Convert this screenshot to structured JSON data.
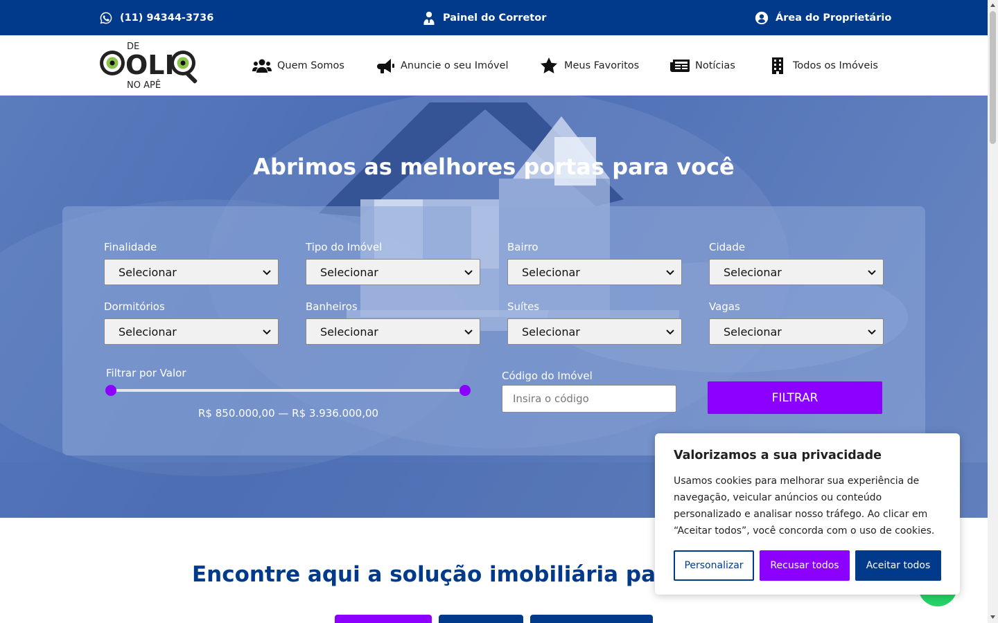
{
  "topbar": {
    "phone": "(11) 94344-3736",
    "broker_panel": "Painel do Corretor",
    "owner_area": "Área do Proprietário"
  },
  "logo": {
    "top": "DE",
    "main": "OLH",
    "bottom": "NO APÊ"
  },
  "nav": [
    {
      "label": "Quem Somos",
      "icon": "users-icon"
    },
    {
      "label": "Anuncie o seu Imóvel",
      "icon": "megaphone-icon"
    },
    {
      "label": "Meus Favoritos",
      "icon": "star-icon"
    },
    {
      "label": "Notícias",
      "icon": "newspaper-icon"
    },
    {
      "label": "Todos os Imóveis",
      "icon": "building-icon"
    }
  ],
  "hero": {
    "title": "Abrimos as melhores portas para você"
  },
  "filters": {
    "fields": [
      {
        "label": "Finalidade",
        "value": "Selecionar"
      },
      {
        "label": "Tipo do Imóvel",
        "value": "Selecionar"
      },
      {
        "label": "Bairro",
        "value": "Selecionar"
      },
      {
        "label": "Cidade",
        "value": "Selecionar"
      },
      {
        "label": "Dormitórios",
        "value": "Selecionar"
      },
      {
        "label": "Banheiros",
        "value": "Selecionar"
      },
      {
        "label": "Suítes",
        "value": "Selecionar"
      },
      {
        "label": "Vagas",
        "value": "Selecionar"
      }
    ],
    "price": {
      "label": "Filtrar por Valor",
      "range_text": "R$ 850.000,00 — R$ 3.936.000,00",
      "min_fraction": 0.0,
      "max_fraction": 1.0
    },
    "code": {
      "label": "Código do Imóvel",
      "placeholder": "Insira o código"
    },
    "submit": "FILTRAR"
  },
  "section": {
    "title": "Encontre aqui a solução imobiliária para"
  },
  "cookie": {
    "title": "Valorizamos a sua privacidade",
    "text": "Usamos cookies para melhorar sua experiência de navegação, veicular anúncios ou conteúdo personalizado e analisar nosso tráfego. Ao clicar em “Aceitar todos”, você concorda com o uso de cookies.",
    "customize": "Personalizar",
    "reject": "Recusar todos",
    "accept": "Aceitar todos"
  },
  "colors": {
    "primary_blue": "#023a8b",
    "accent_purple": "#8c00ff",
    "whatsapp_green": "#25d366"
  }
}
